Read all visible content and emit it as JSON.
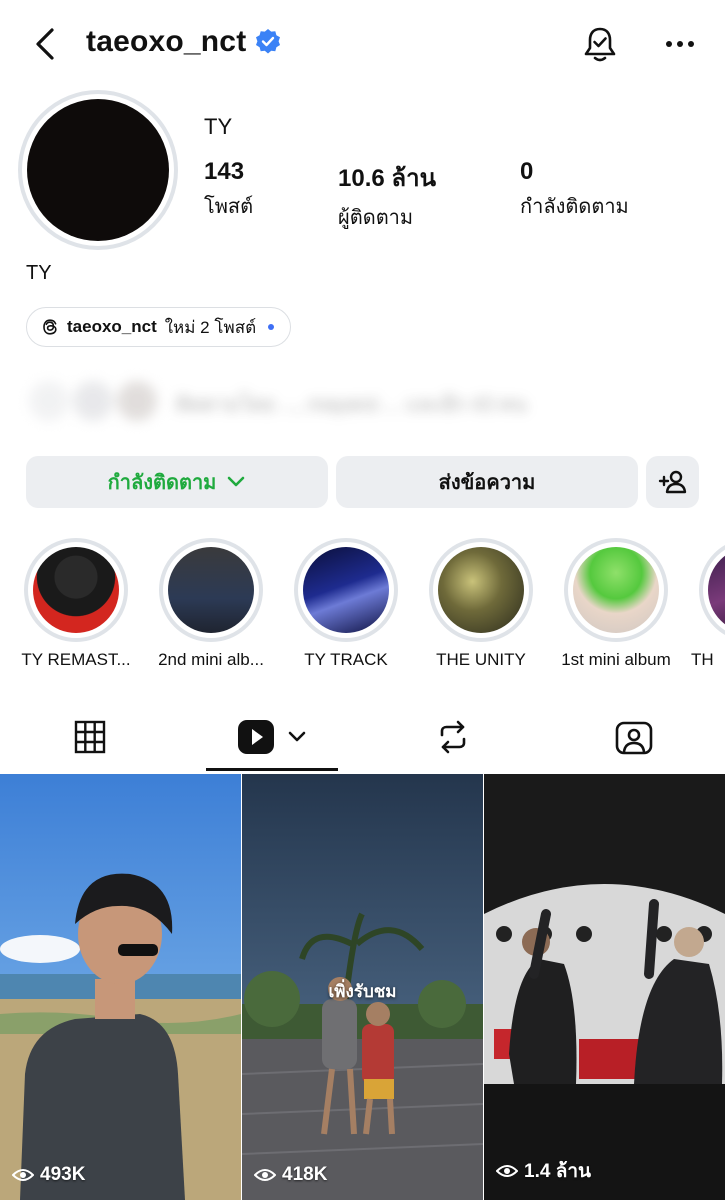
{
  "header": {
    "username": "taeoxo_nct",
    "verified_color": "#3b82f6"
  },
  "profile": {
    "display_name": "TY",
    "bio_name": "TY",
    "stats": {
      "posts": {
        "value": "143",
        "label": "โพสต์"
      },
      "followers": {
        "value": "10.6 ล้าน",
        "label": "ผู้ติดตาม"
      },
      "following": {
        "value": "0",
        "label": "กำลังติดตาม"
      }
    }
  },
  "threads": {
    "icon": "threads-icon",
    "handle": "taeoxo_nct",
    "text": "ใหม่ 2 โพสต์"
  },
  "followed_by": {
    "text": "ติดตามโดย ..., mayarsi ... และอีก 43 คน"
  },
  "buttons": {
    "following_label": "กำลังติดตาม",
    "message_label": "ส่งข้อความ",
    "accent_green": "#1faa3e"
  },
  "highlights": [
    {
      "label": "TY REMAST..."
    },
    {
      "label": "2nd mini alb..."
    },
    {
      "label": "TY TRACK"
    },
    {
      "label": "THE UNITY"
    },
    {
      "label": "1st mini album"
    },
    {
      "label": "TH"
    }
  ],
  "tabs": [
    {
      "name": "grid-icon"
    },
    {
      "name": "reels-icon"
    },
    {
      "name": "repost-icon"
    },
    {
      "name": "tagged-icon"
    }
  ],
  "posts": [
    {
      "views": "493K",
      "badge": ""
    },
    {
      "views": "418K",
      "badge": "เพิ่งรับชม"
    },
    {
      "views": "1.4 ล้าน",
      "badge": ""
    }
  ]
}
